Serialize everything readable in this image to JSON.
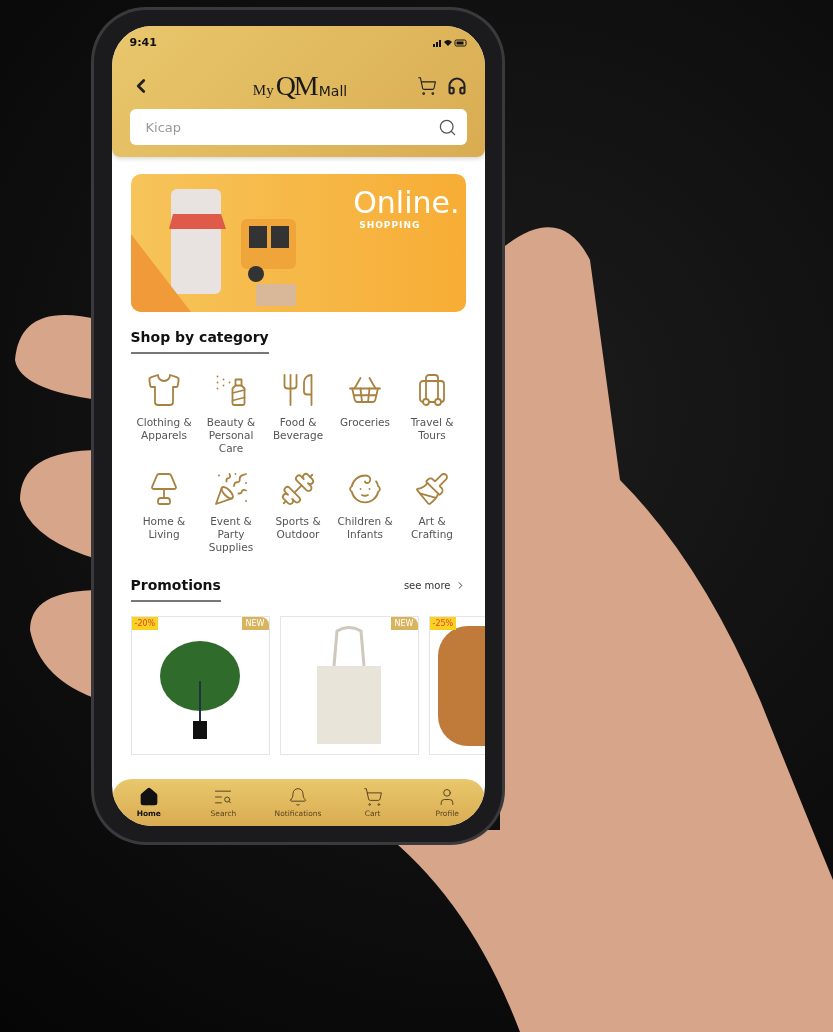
{
  "status_bar": {
    "time": "9:41"
  },
  "header": {
    "logo": {
      "prefix": "My",
      "mark": "QM",
      "suffix": "Mall"
    },
    "search": {
      "placeholder": "Kicap"
    }
  },
  "banner": {
    "title": "Online.",
    "subtitle": "SHOPPING"
  },
  "categories": {
    "title": "Shop by category",
    "items": [
      {
        "label": "Clothing & Apparels"
      },
      {
        "label": "Beauty & Personal Care"
      },
      {
        "label": "Food & Beverage"
      },
      {
        "label": "Groceries"
      },
      {
        "label": "Travel & Tours"
      },
      {
        "label": "Home & Living"
      },
      {
        "label": "Event & Party Supplies"
      },
      {
        "label": "Sports & Outdoor"
      },
      {
        "label": "Children & Infants"
      },
      {
        "label": "Art & Crafting"
      }
    ]
  },
  "promotions": {
    "title": "Promotions",
    "link": "see more",
    "products": [
      {
        "discount": "-20%",
        "badge": "NEW",
        "kind": "plant"
      },
      {
        "badge": "NEW",
        "kind": "bag"
      },
      {
        "discount": "-25%",
        "kind": "almonds"
      }
    ]
  },
  "bottom_nav": [
    {
      "label": "Home",
      "selected": true
    },
    {
      "label": "Search",
      "selected": false
    },
    {
      "label": "Notifications",
      "selected": false
    },
    {
      "label": "Cart",
      "selected": false
    },
    {
      "label": "Profile",
      "selected": false
    }
  ]
}
